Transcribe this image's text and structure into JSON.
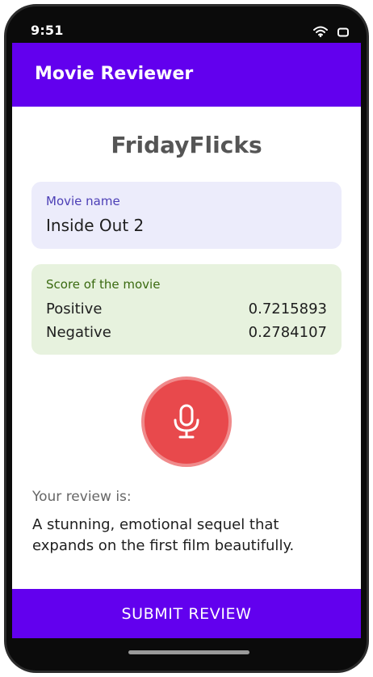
{
  "status_bar": {
    "time": "9:51",
    "icons": [
      "wifi-icon",
      "battery-icon"
    ]
  },
  "app_bar": {
    "title": "Movie Reviewer"
  },
  "brand": "FridayFlicks",
  "movie": {
    "caption": "Movie name",
    "name": "Inside Out 2"
  },
  "score": {
    "caption": "Score of the movie",
    "positive_label": "Positive",
    "positive_value": "0.7215893",
    "negative_label": "Negative",
    "negative_value": "0.2784107"
  },
  "mic": {
    "icon": "microphone-icon"
  },
  "review": {
    "caption": "Your review is:",
    "text": "A stunning, emotional sequel that expands on the first film beautifully."
  },
  "submit": {
    "label": "SUBMIT REVIEW"
  },
  "colors": {
    "primary": "#6200ee",
    "movie_card_bg": "#ececfb",
    "score_card_bg": "#e7f2de",
    "mic_button": "#e8494c"
  }
}
